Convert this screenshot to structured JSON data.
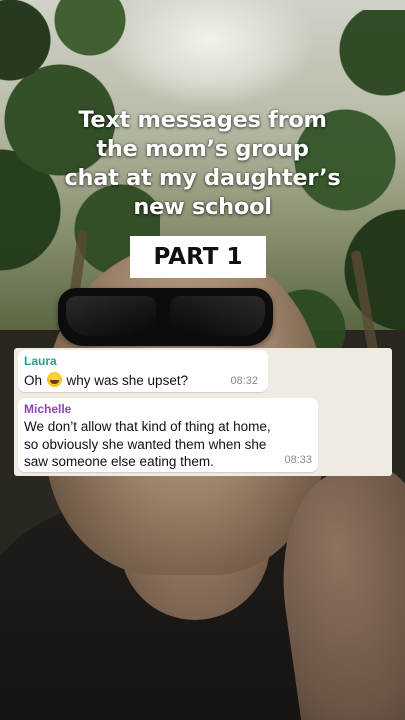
{
  "headline": {
    "line1": "Text messages from",
    "line2": "the mom’s group",
    "line3": "chat at my daughter’s",
    "line4": "new school"
  },
  "badge": {
    "label": "PART 1"
  },
  "chat": {
    "messages": [
      {
        "sender": "Laura",
        "sender_color": "#2a9d8f",
        "text_before_emoji": "Oh ",
        "emoji": "face-with-tears-of-joy-icon",
        "text_after_emoji": " why was she upset?",
        "time": "08:32"
      },
      {
        "sender": "Michelle",
        "sender_color": "#8e44ad",
        "line1": "We don’t allow that kind of thing at home,",
        "line2": "so obviously she wanted them when she",
        "line3": "saw someone else eating them.",
        "time": "08:33"
      }
    ]
  },
  "colors": {
    "chat_background": "#efeae2",
    "bubble_background": "#ffffff",
    "headline_text": "#ffffff"
  }
}
